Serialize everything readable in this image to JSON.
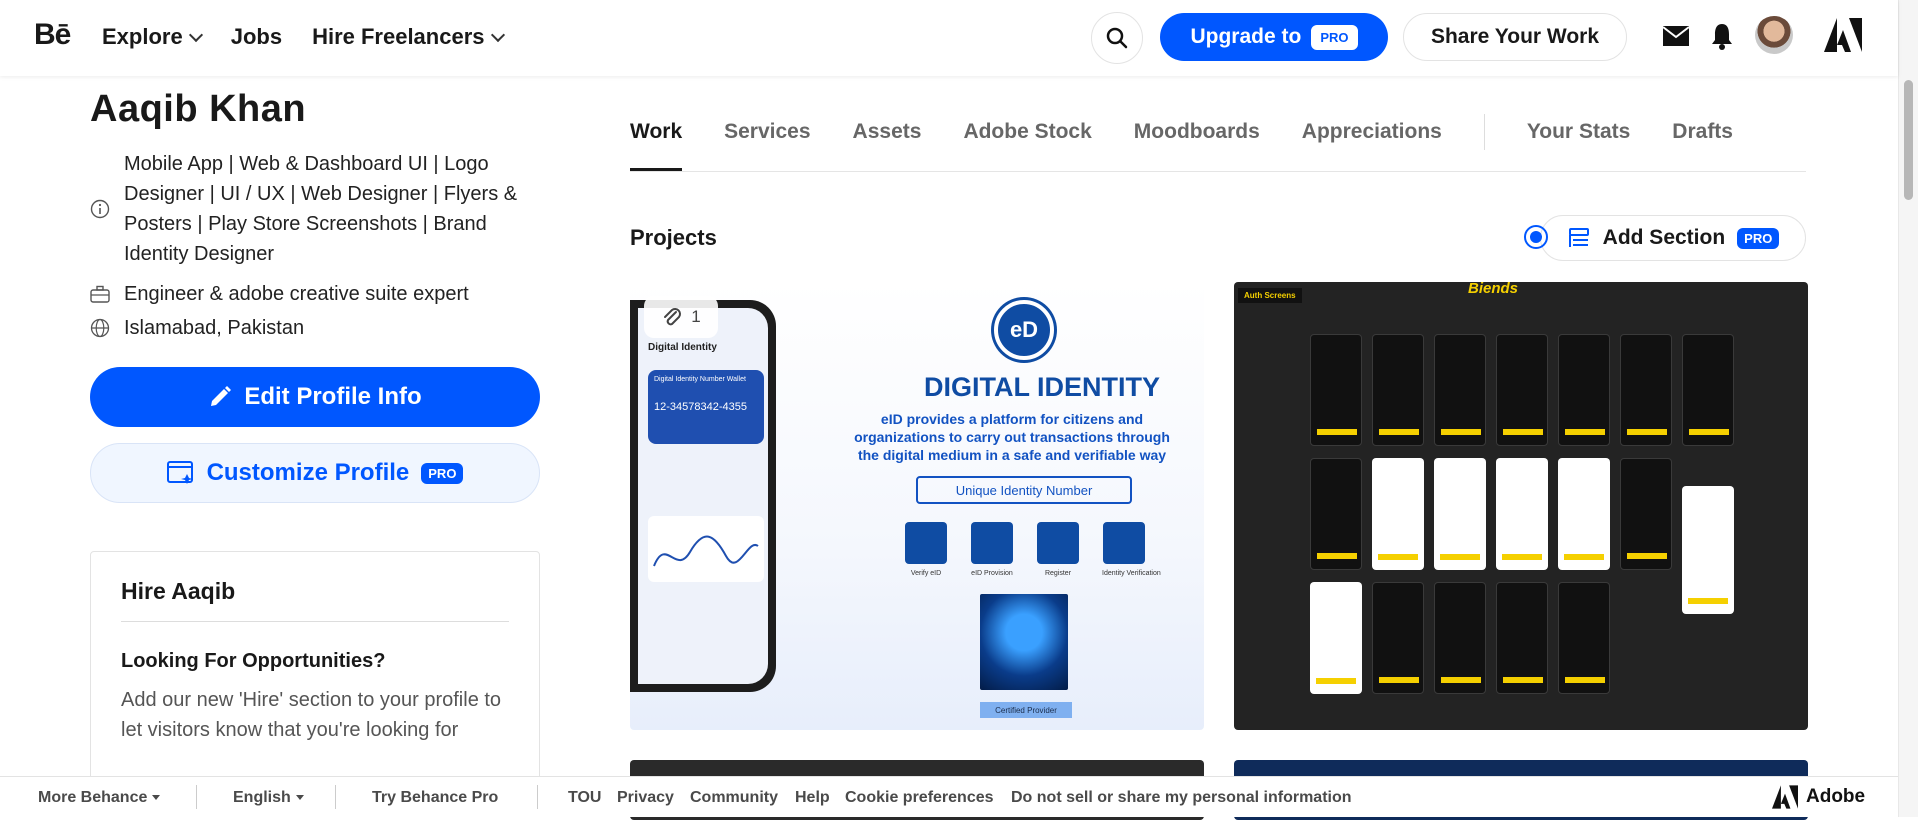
{
  "header": {
    "logo": "Bē",
    "nav": [
      {
        "label": "Explore",
        "dropdown": true
      },
      {
        "label": "Jobs",
        "dropdown": false
      },
      {
        "label": "Hire Freelancers",
        "dropdown": true
      }
    ],
    "upgrade_label": "Upgrade to",
    "pro_label": "PRO",
    "share_label": "Share Your Work",
    "accent_color": "#0057ff"
  },
  "profile": {
    "name": "Aaqib Khan",
    "bio": "Mobile App | Web & Dashboard UI | Logo Designer | UI / UX | Web Designer | Flyers & Posters | Play Store Screenshots | Brand Identity Designer",
    "occupation": "Engineer & adobe creative suite expert",
    "location": "Islamabad, Pakistan",
    "edit_label": "Edit Profile Info",
    "customize_label": "Customize Profile",
    "pro_label": "PRO"
  },
  "hire": {
    "title": "Hire Aaqib",
    "subtitle": "Looking For Opportunities?",
    "text": "Add our new 'Hire' section to your profile to let visitors know that you're looking for"
  },
  "tabs": [
    {
      "label": "Work",
      "active": true
    },
    {
      "label": "Services"
    },
    {
      "label": "Assets"
    },
    {
      "label": "Adobe Stock"
    },
    {
      "label": "Moodboards"
    },
    {
      "label": "Appreciations"
    },
    {
      "label": "Your Stats"
    },
    {
      "label": "Drafts"
    }
  ],
  "projects": {
    "title": "Projects",
    "add_section_label": "Add Section",
    "pro_label": "PRO",
    "card1": {
      "attachment_count": "1",
      "phone_title": "Digital Identity",
      "phone_card_label": "Digital Identity Number Wallet",
      "phone_number": "12-34578342-4355",
      "logo_text": "eD",
      "headline": "DIGITAL IDENTITY",
      "description": "eID provides a platform for citizens and organizations to carry out transactions through the digital medium in a safe and verifiable way",
      "button_label": "Unique Identity Number",
      "features": [
        "Verify eID",
        "eID Provision",
        "Register",
        "Identity Verification"
      ],
      "certified_label": "Certified Provider"
    },
    "card2": {
      "tag": "Auth Screens",
      "brand": "Biends"
    }
  },
  "footer": {
    "more_label": "More Behance",
    "language": "English",
    "try_pro": "Try Behance Pro",
    "links": [
      "TOU",
      "Privacy",
      "Community",
      "Help",
      "Cookie preferences",
      "Do not sell or share my personal information"
    ],
    "adobe_label": "Adobe"
  }
}
